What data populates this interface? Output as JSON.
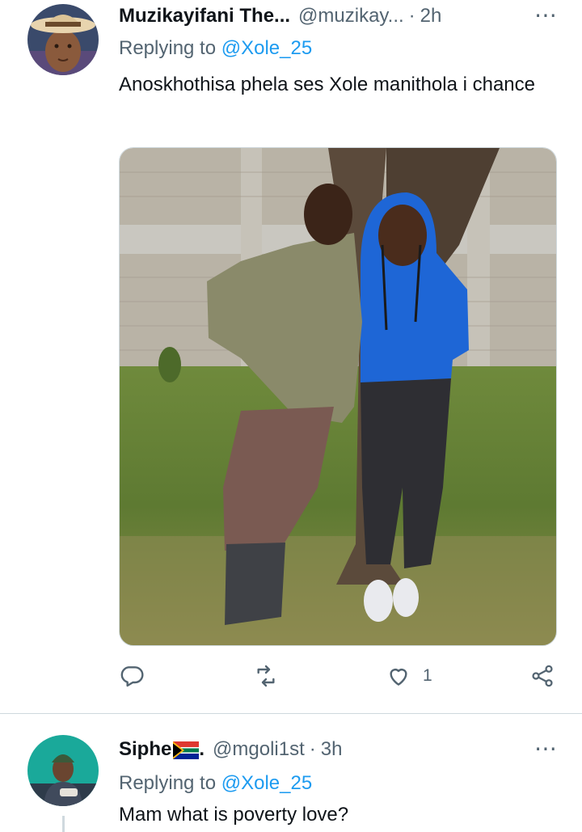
{
  "tweets": [
    {
      "display_name": "Muzikayifani The...",
      "handle": "@muzikay...",
      "separator": "·",
      "time": "2h",
      "more_icon": "⋯",
      "replying_prefix": "Replying to",
      "replying_to": "@Xole_25",
      "text": "Anoskhothisa phela ses Xole manithola i chance",
      "has_media": true,
      "actions": {
        "reply_count": "",
        "retweet_count": "",
        "like_count": "1"
      }
    },
    {
      "display_name": "Siphe",
      "name_suffix": ".",
      "handle": "@mgoli1st",
      "separator": "·",
      "time": "3h",
      "more_icon": "⋯",
      "replying_prefix": "Replying to",
      "replying_to": "@Xole_25",
      "text": "Mam what is poverty love?"
    }
  ],
  "icons": [
    "reply-icon",
    "retweet-icon",
    "like-icon",
    "share-icon",
    "south-africa-flag-icon"
  ],
  "colors": {
    "link": "#1d9bf0",
    "secondary_text": "#536471",
    "primary_text": "#0f1419",
    "divider": "#cfd9de"
  }
}
